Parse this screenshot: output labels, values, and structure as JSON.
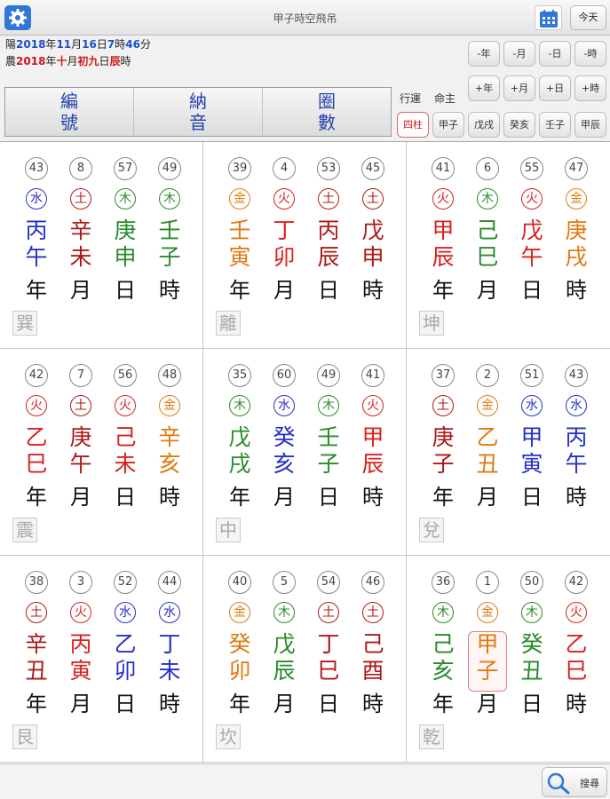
{
  "title": "甲子時空飛吊",
  "today_label": "今天",
  "date_lines": {
    "solar": [
      [
        "陽",
        ""
      ],
      [
        "2018",
        "blue"
      ],
      [
        "年",
        ""
      ],
      [
        "11",
        "blue"
      ],
      [
        "月",
        ""
      ],
      [
        "16",
        "blue"
      ],
      [
        "日",
        ""
      ],
      [
        "7",
        "blue"
      ],
      [
        "時",
        ""
      ],
      [
        "46",
        "blue"
      ],
      [
        "分",
        ""
      ]
    ],
    "lunar": [
      [
        "農",
        ""
      ],
      [
        "2018",
        "red"
      ],
      [
        "年",
        ""
      ],
      [
        "十",
        "red"
      ],
      [
        "月",
        ""
      ],
      [
        "初九",
        "red"
      ],
      [
        "日",
        ""
      ],
      [
        "辰",
        "red"
      ],
      [
        "時",
        ""
      ]
    ]
  },
  "tabs": [
    "編\n號",
    "納\n音",
    "圈\n數"
  ],
  "controls": {
    "minus": [
      "-年",
      "-月",
      "-日",
      "-時"
    ],
    "plus": [
      "+年",
      "+月",
      "+日",
      "+時"
    ],
    "labels": [
      "行運",
      "命主"
    ],
    "pillars": [
      "四柱",
      "甲子",
      "戊戌",
      "癸亥",
      "壬子",
      "甲辰"
    ]
  },
  "palaces": [
    {
      "trigram": "巽",
      "cols": [
        {
          "num": "43",
          "el": "水",
          "ec": "water",
          "stem": "丙",
          "sc": "water",
          "branch": "午",
          "bc": "water",
          "pos": "年"
        },
        {
          "num": "8",
          "el": "土",
          "ec": "earth",
          "stem": "辛",
          "sc": "earth",
          "branch": "未",
          "bc": "earth",
          "pos": "月"
        },
        {
          "num": "57",
          "el": "木",
          "ec": "wood",
          "stem": "庚",
          "sc": "wood",
          "branch": "申",
          "bc": "wood",
          "pos": "日"
        },
        {
          "num": "49",
          "el": "木",
          "ec": "wood",
          "stem": "壬",
          "sc": "wood",
          "branch": "子",
          "bc": "wood",
          "pos": "時"
        }
      ]
    },
    {
      "trigram": "離",
      "cols": [
        {
          "num": "39",
          "el": "金",
          "ec": "metal",
          "stem": "壬",
          "sc": "metal",
          "branch": "寅",
          "bc": "metal",
          "pos": "年"
        },
        {
          "num": "4",
          "el": "火",
          "ec": "fire",
          "stem": "丁",
          "sc": "fire",
          "branch": "卯",
          "bc": "fire",
          "pos": "月"
        },
        {
          "num": "53",
          "el": "土",
          "ec": "earth",
          "stem": "丙",
          "sc": "earth",
          "branch": "辰",
          "bc": "earth",
          "pos": "日"
        },
        {
          "num": "45",
          "el": "土",
          "ec": "earth",
          "stem": "戊",
          "sc": "earth",
          "branch": "申",
          "bc": "earth",
          "pos": "時"
        }
      ]
    },
    {
      "trigram": "坤",
      "cols": [
        {
          "num": "41",
          "el": "火",
          "ec": "fire",
          "stem": "甲",
          "sc": "fire",
          "branch": "辰",
          "bc": "fire",
          "pos": "年"
        },
        {
          "num": "6",
          "el": "木",
          "ec": "wood",
          "stem": "己",
          "sc": "wood",
          "branch": "巳",
          "bc": "wood",
          "pos": "月"
        },
        {
          "num": "55",
          "el": "火",
          "ec": "fire",
          "stem": "戊",
          "sc": "fire",
          "branch": "午",
          "bc": "fire",
          "pos": "日"
        },
        {
          "num": "47",
          "el": "金",
          "ec": "metal",
          "stem": "庚",
          "sc": "metal",
          "branch": "戌",
          "bc": "metal",
          "pos": "時"
        }
      ]
    },
    {
      "trigram": "震",
      "cols": [
        {
          "num": "42",
          "el": "火",
          "ec": "fire",
          "stem": "乙",
          "sc": "fire",
          "branch": "巳",
          "bc": "fire",
          "pos": "年"
        },
        {
          "num": "7",
          "el": "土",
          "ec": "earth",
          "stem": "庚",
          "sc": "earth",
          "branch": "午",
          "bc": "earth",
          "pos": "月"
        },
        {
          "num": "56",
          "el": "火",
          "ec": "fire",
          "stem": "己",
          "sc": "fire",
          "branch": "未",
          "bc": "fire",
          "pos": "日"
        },
        {
          "num": "48",
          "el": "金",
          "ec": "metal",
          "stem": "辛",
          "sc": "metal",
          "branch": "亥",
          "bc": "metal",
          "pos": "時"
        }
      ]
    },
    {
      "trigram": "中",
      "cols": [
        {
          "num": "35",
          "el": "木",
          "ec": "wood",
          "stem": "戊",
          "sc": "wood",
          "branch": "戌",
          "bc": "wood",
          "pos": "年"
        },
        {
          "num": "60",
          "el": "水",
          "ec": "water",
          "stem": "癸",
          "sc": "water",
          "branch": "亥",
          "bc": "water",
          "pos": "月"
        },
        {
          "num": "49",
          "el": "木",
          "ec": "wood",
          "stem": "壬",
          "sc": "wood",
          "branch": "子",
          "bc": "wood",
          "pos": "日"
        },
        {
          "num": "41",
          "el": "火",
          "ec": "fire",
          "stem": "甲",
          "sc": "fire",
          "branch": "辰",
          "bc": "fire",
          "pos": "時"
        }
      ]
    },
    {
      "trigram": "兌",
      "cols": [
        {
          "num": "37",
          "el": "土",
          "ec": "earth",
          "stem": "庚",
          "sc": "earth",
          "branch": "子",
          "bc": "earth",
          "pos": "年"
        },
        {
          "num": "2",
          "el": "金",
          "ec": "metal",
          "stem": "乙",
          "sc": "metal",
          "branch": "丑",
          "bc": "metal",
          "pos": "月"
        },
        {
          "num": "51",
          "el": "水",
          "ec": "water",
          "stem": "甲",
          "sc": "water",
          "branch": "寅",
          "bc": "water",
          "pos": "日"
        },
        {
          "num": "43",
          "el": "水",
          "ec": "water",
          "stem": "丙",
          "sc": "water",
          "branch": "午",
          "bc": "water",
          "pos": "時"
        }
      ]
    },
    {
      "trigram": "艮",
      "cols": [
        {
          "num": "38",
          "el": "土",
          "ec": "earth",
          "stem": "辛",
          "sc": "earth",
          "branch": "丑",
          "bc": "earth",
          "pos": "年"
        },
        {
          "num": "3",
          "el": "火",
          "ec": "fire",
          "stem": "丙",
          "sc": "fire",
          "branch": "寅",
          "bc": "fire",
          "pos": "月"
        },
        {
          "num": "52",
          "el": "水",
          "ec": "water",
          "stem": "乙",
          "sc": "water",
          "branch": "卯",
          "bc": "water",
          "pos": "日"
        },
        {
          "num": "44",
          "el": "水",
          "ec": "water",
          "stem": "丁",
          "sc": "water",
          "branch": "未",
          "bc": "water",
          "pos": "時"
        }
      ]
    },
    {
      "trigram": "坎",
      "cols": [
        {
          "num": "40",
          "el": "金",
          "ec": "metal",
          "stem": "癸",
          "sc": "metal",
          "branch": "卯",
          "bc": "metal",
          "pos": "年"
        },
        {
          "num": "5",
          "el": "木",
          "ec": "wood",
          "stem": "戊",
          "sc": "wood",
          "branch": "辰",
          "bc": "wood",
          "pos": "月"
        },
        {
          "num": "54",
          "el": "土",
          "ec": "earth",
          "stem": "丁",
          "sc": "earth",
          "branch": "巳",
          "bc": "earth",
          "pos": "日"
        },
        {
          "num": "46",
          "el": "土",
          "ec": "earth",
          "stem": "己",
          "sc": "earth",
          "branch": "酉",
          "bc": "earth",
          "pos": "時"
        }
      ]
    },
    {
      "trigram": "乾",
      "cols": [
        {
          "num": "36",
          "el": "木",
          "ec": "wood",
          "stem": "己",
          "sc": "wood",
          "branch": "亥",
          "bc": "wood",
          "pos": "年"
        },
        {
          "num": "1",
          "el": "金",
          "ec": "metal",
          "stem": "甲",
          "sc": "metal",
          "branch": "子",
          "bc": "metal",
          "pos": "月",
          "highlight": true
        },
        {
          "num": "50",
          "el": "木",
          "ec": "wood",
          "stem": "癸",
          "sc": "wood",
          "branch": "丑",
          "bc": "wood",
          "pos": "日"
        },
        {
          "num": "42",
          "el": "火",
          "ec": "fire",
          "stem": "乙",
          "sc": "fire",
          "branch": "巳",
          "bc": "fire",
          "pos": "時"
        }
      ]
    }
  ],
  "search_label": "搜尋",
  "colors": {
    "water": "#2430c8",
    "fire": "#d92020",
    "earth": "#b01818",
    "wood": "#2a8a2a",
    "metal": "#e07a10",
    "accent": "#2f78d8"
  }
}
